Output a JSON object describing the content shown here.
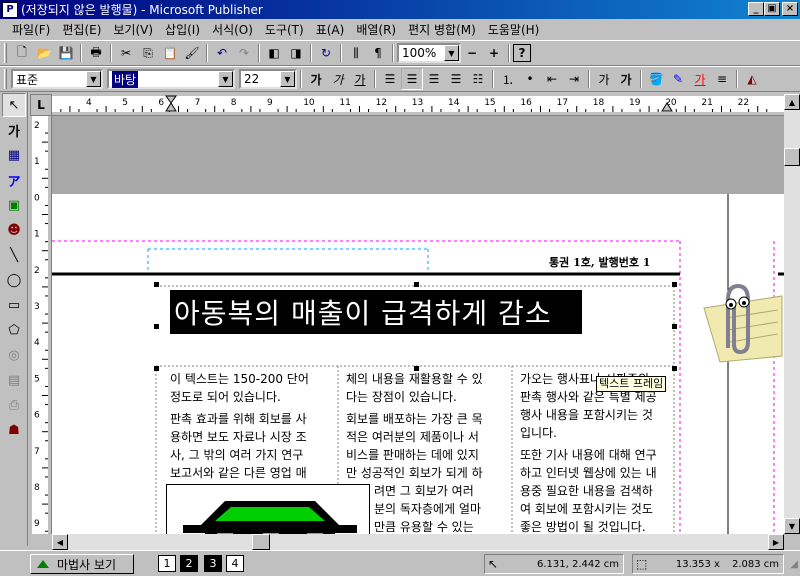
{
  "window": {
    "title": "(저장되지 않은 발행물) - Microsoft Publisher",
    "app_icon": "publisher-icon",
    "controls": [
      "_",
      "▣",
      "×"
    ]
  },
  "menubar": {
    "items": [
      "파일(F)",
      "편집(E)",
      "보기(V)",
      "삽입(I)",
      "서식(O)",
      "도구(T)",
      "표(A)",
      "배열(R)",
      "편지 병합(M)",
      "도움말(H)"
    ]
  },
  "toolbar_standard": {
    "zoom": "100%"
  },
  "toolbar_format": {
    "style": "표준",
    "font": "바탕",
    "size": "22"
  },
  "document": {
    "header_text": "통권 1호, 발행번호 1",
    "headline": "아동복의 매출이 급격하게 감소",
    "col1": [
      "이 텍스트는 150-200 단어",
      "정도로 되어 있습니다.",
      "판촉 효과를 위해 회보를 사",
      "용하면 보도 자료나 시장 조",
      "사, 그 밖의 여러 가지 연구",
      "보고서와 같은 다른 영업 매"
    ],
    "col2": [
      "체의 내용을 재활용할 수 있",
      "다는 장점이 있습니다.",
      "회보를 배포하는 가장 큰 목",
      "적은 여러분의 제품이나 서",
      "비스를 판매하는 데에 있지",
      "만 성공적인 회보가 되게 하",
      "려면 그 회보가 여러",
      "분의 독자층에게 얼마",
      "만큼 유용할 수 있는"
    ],
    "col3": [
      "가오는 행사표나 시판주의",
      "판촉 행사와 같은 특별 제공",
      "행사 내용을 포함시키는 것",
      "입니다.",
      "또한 기사 내용에 대해 연구",
      "하고 인터넷 웹상에 있는 내",
      "용중 필요한 내용을 검색하",
      "여 회보에 포함시키는 것도",
      "좋은 방법이 될 것입니다."
    ],
    "tooltip": "텍스트 프레임"
  },
  "status": {
    "wizard_label": "마법사 보기",
    "pages": [
      "1",
      "2",
      "3",
      "4"
    ],
    "position": "6.131, 2.442 cm",
    "size_w": "13.353 x",
    "size_h": "2.083 cm"
  },
  "ruler": {
    "h_labels": [
      "4",
      "5",
      "6",
      "7",
      "8",
      "9",
      "10",
      "11",
      "12",
      "13",
      "14",
      "15",
      "16",
      "17",
      "18",
      "19",
      "20",
      "21",
      "22"
    ],
    "v_labels": [
      "2",
      "1",
      "0",
      "1",
      "2",
      "3",
      "4",
      "5",
      "6",
      "7",
      "8",
      "9",
      "10"
    ]
  }
}
